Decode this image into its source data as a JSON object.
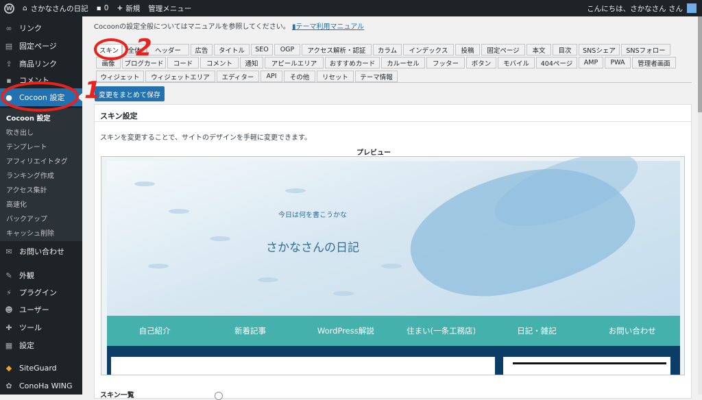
{
  "adminbar": {
    "site_name": "さかなさんの日記",
    "comments_count": "0",
    "new_label": "新規",
    "admin_menu_label": "管理メニュー",
    "greeting": "こんにちは、さかなさん さん"
  },
  "sidebar": {
    "items": [
      {
        "icon": "link-icon",
        "label": "リンク"
      },
      {
        "icon": "page-icon",
        "label": "固定ページ"
      },
      {
        "icon": "product-link-icon",
        "label": "商品リンク"
      },
      {
        "icon": "comment-icon",
        "label": "コメント"
      },
      {
        "icon": "cocoon-icon",
        "label": "Cocoon 設定"
      },
      {
        "icon": "mail-icon",
        "label": "お問い合わせ"
      },
      {
        "icon": "appearance-icon",
        "label": "外観"
      },
      {
        "icon": "plugin-icon",
        "label": "プラグイン"
      },
      {
        "icon": "user-icon",
        "label": "ユーザー"
      },
      {
        "icon": "tool-icon",
        "label": "ツール"
      },
      {
        "icon": "settings-icon",
        "label": "設定"
      },
      {
        "icon": "siteguard-icon",
        "label": "SiteGuard"
      },
      {
        "icon": "conoha-icon",
        "label": "ConoHa WING"
      }
    ],
    "submenu": [
      "Cocoon 設定",
      "吹き出し",
      "テンプレート",
      "アフィリエイトタグ",
      "ランキング作成",
      "アクセス集計",
      "高速化",
      "バックアップ",
      "キャッシュ削除"
    ]
  },
  "main": {
    "notice_text": "Cocoonの設定全般についてはマニュアルを参照してください。",
    "notice_link": "テーマ利用マニュアル",
    "tabs_row1": [
      "スキン",
      "全体",
      "ヘッダー",
      "広告",
      "タイトル",
      "SEO",
      "OGP",
      "アクセス解析・認証",
      "カラム",
      "インデックス",
      "投稿",
      "固定ページ",
      "本文",
      "目次",
      "SNSシェア",
      "SNSフォロー"
    ],
    "tabs_row2": [
      "画像",
      "ブログカード",
      "コード",
      "コメント",
      "通知",
      "アピールエリア",
      "おすすめカード",
      "カルーセル",
      "フッター",
      "ボタン",
      "モバイル",
      "404ページ",
      "AMP",
      "PWA",
      "管理者画面"
    ],
    "tabs_row3": [
      "ウィジェット",
      "ウィジェットエリア",
      "エディター",
      "API",
      "その他",
      "リセット",
      "テーマ情報"
    ],
    "save_button": "変更をまとめて保存",
    "panel_title": "スキン設定",
    "panel_desc": "スキンを変更することで、サイトのデザインを手軽に変更できます。",
    "preview_label": "プレビュー",
    "preview": {
      "tagline": "今日は何を書こうかな",
      "site_title": "さかなさんの日記",
      "nav": [
        "自己紹介",
        "新着記事",
        "WordPress解説",
        "住まい(一条工務店)",
        "日記・雑記",
        "お問い合わせ"
      ]
    },
    "skin_list_label": "スキン一覧"
  },
  "annotations": {
    "one": "1",
    "two": "2"
  },
  "colors": {
    "admin_bg": "#1d2327",
    "accent": "#2271b1",
    "nav_teal": "#45b1ad",
    "annotation_red": "#e8221d"
  }
}
